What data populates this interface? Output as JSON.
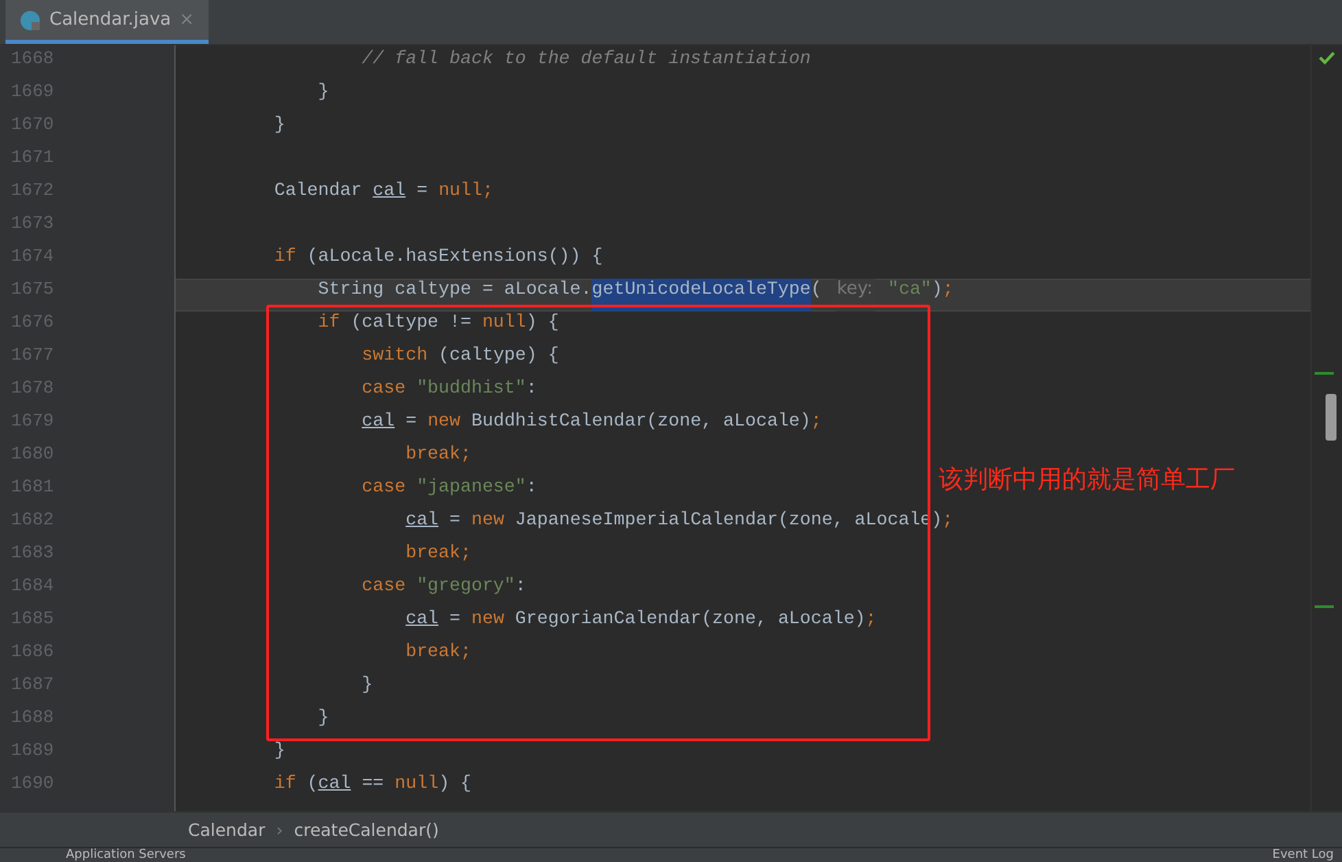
{
  "tabs": [
    {
      "label": "Calendar.java",
      "selected": true,
      "close": "×"
    }
  ],
  "editor": {
    "lines": [
      {
        "number": "1668",
        "current": false,
        "tokens": [
          {
            "kind": "comment",
            "text": "                // fall back to the default instantiation"
          }
        ]
      },
      {
        "number": "1669",
        "current": false,
        "tokens": [
          {
            "kind": "plain",
            "text": "            }"
          }
        ]
      },
      {
        "number": "1670",
        "current": false,
        "tokens": [
          {
            "kind": "plain",
            "text": "        }"
          }
        ]
      },
      {
        "number": "1671",
        "current": false
      },
      {
        "number": "1672",
        "current": false,
        "tokens": [
          {
            "kind": "plain",
            "text": "        Calendar "
          },
          {
            "kind": "var",
            "text": "cal"
          },
          {
            "kind": "plain",
            "text": " = "
          },
          {
            "kind": "keyword",
            "text": "null;"
          }
        ]
      },
      {
        "number": "1673",
        "current": false
      },
      {
        "number": "1674",
        "current": false,
        "tokens": [
          {
            "kind": "keyword",
            "text": "        if"
          },
          {
            "kind": "plain",
            "text": " (aLocale.hasExtensions()) {"
          }
        ]
      },
      {
        "number": "1675",
        "current": true,
        "tokens": [
          {
            "kind": "plain",
            "text": "            String caltype = aLocale."
          },
          {
            "kind": "selected",
            "text": "getUnicodeLocaleType"
          },
          {
            "kind": "plain",
            "text": "( "
          },
          {
            "kind": "hint",
            "text": "key:"
          },
          {
            "kind": "string",
            "text": " \"ca\""
          },
          {
            "kind": "plain",
            "text": ")"
          },
          {
            "kind": "keyword",
            "text": ";"
          }
        ]
      },
      {
        "number": "1676",
        "current": false,
        "tokens": [
          {
            "kind": "keyword",
            "text": "            if"
          },
          {
            "kind": "plain",
            "text": " (caltype != "
          },
          {
            "kind": "keyword",
            "text": "null"
          },
          {
            "kind": "plain",
            "text": ") {"
          }
        ]
      },
      {
        "number": "1677",
        "current": false,
        "tokens": [
          {
            "kind": "keyword",
            "text": "                switch"
          },
          {
            "kind": "plain",
            "text": " (caltype) {"
          }
        ]
      },
      {
        "number": "1678",
        "current": false,
        "tokens": [
          {
            "kind": "keyword",
            "text": "                case "
          },
          {
            "kind": "string",
            "text": "\"buddhist\""
          },
          {
            "kind": "plain",
            "text": ":"
          }
        ]
      },
      {
        "number": "1679",
        "current": false,
        "tokens": [
          {
            "kind": "var",
            "text": "                cal"
          },
          {
            "kind": "plain",
            "text": " = "
          },
          {
            "kind": "keyword",
            "text": "new"
          },
          {
            "kind": "plain",
            "text": " BuddhistCalendar(zone, aLocale)"
          },
          {
            "kind": "keyword",
            "text": ";"
          }
        ]
      },
      {
        "number": "1680",
        "current": false,
        "tokens": [
          {
            "kind": "keyword",
            "text": "                    break;"
          }
        ]
      },
      {
        "number": "1681",
        "current": false,
        "tokens": [
          {
            "kind": "keyword",
            "text": "                case "
          },
          {
            "kind": "string",
            "text": "\"japanese\""
          },
          {
            "kind": "plain",
            "text": ":"
          }
        ]
      },
      {
        "number": "1682",
        "current": false,
        "tokens": [
          {
            "kind": "var",
            "text": "                    cal"
          },
          {
            "kind": "plain",
            "text": " = "
          },
          {
            "kind": "keyword",
            "text": "new"
          },
          {
            "kind": "plain",
            "text": " JapaneseImperialCalendar(zone, aLocale)"
          },
          {
            "kind": "keyword",
            "text": ";"
          }
        ]
      },
      {
        "number": "1683",
        "current": false,
        "tokens": [
          {
            "kind": "keyword",
            "text": "                    break;"
          }
        ]
      },
      {
        "number": "1684",
        "current": false,
        "tokens": [
          {
            "kind": "keyword",
            "text": "                case "
          },
          {
            "kind": "string",
            "text": "\"gregory\""
          },
          {
            "kind": "plain",
            "text": ":"
          }
        ]
      },
      {
        "number": "1685",
        "current": false,
        "tokens": [
          {
            "kind": "var",
            "text": "                    cal"
          },
          {
            "kind": "plain",
            "text": " = "
          },
          {
            "kind": "keyword",
            "text": "new"
          },
          {
            "kind": "plain",
            "text": " GregorianCalendar(zone, aLocale)"
          },
          {
            "kind": "keyword",
            "text": ";"
          }
        ]
      },
      {
        "number": "1686",
        "current": false,
        "tokens": [
          {
            "kind": "keyword",
            "text": "                    break;"
          }
        ]
      },
      {
        "number": "1687",
        "current": false,
        "tokens": [
          {
            "kind": "plain",
            "text": "                }"
          }
        ]
      },
      {
        "number": "1688",
        "current": false,
        "tokens": [
          {
            "kind": "plain",
            "text": "            }"
          }
        ]
      },
      {
        "number": "1689",
        "current": false,
        "tokens": [
          {
            "kind": "plain",
            "text": "        }"
          }
        ]
      },
      {
        "number": "1690",
        "current": false,
        "tokens": [
          {
            "kind": "keyword",
            "text": "        if"
          },
          {
            "kind": "plain",
            "text": " ("
          },
          {
            "kind": "var",
            "text": "cal"
          },
          {
            "kind": "plain",
            "text": " == "
          },
          {
            "kind": "keyword",
            "text": "null"
          },
          {
            "kind": "plain",
            "text": ") {"
          }
        ]
      }
    ],
    "annotation": {
      "text": "该判断中用的就是简单工厂"
    }
  },
  "breadcrumbs": [
    "Calendar",
    "createCalendar()"
  ],
  "breadcrumb_separator": "›",
  "status_bar": {
    "left": "Application Servers",
    "right": "Event Log"
  }
}
